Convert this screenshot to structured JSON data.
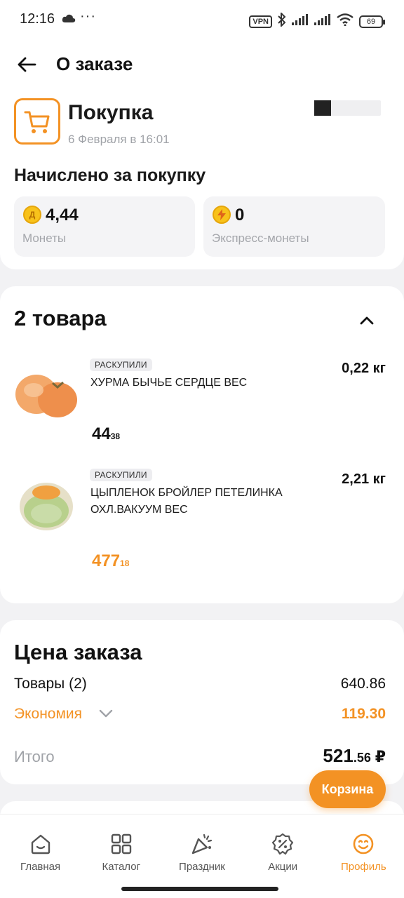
{
  "status_bar": {
    "time": "12:16",
    "dots": "···",
    "vpn": "VPN",
    "battery": "69",
    "icons": [
      "cloud-icon",
      "bluetooth-icon",
      "signal-icon",
      "signal-icon",
      "wifi-icon",
      "battery-icon"
    ]
  },
  "header": {
    "title": "О заказе",
    "back_icon": "arrow-left-icon"
  },
  "purchase": {
    "title": "Покупка",
    "date": "6 Февраля в 16:01",
    "icon": "cart-icon",
    "accrued_title": "Начислено за покупку",
    "coins": {
      "value": "4,44",
      "label": "Монеты",
      "icon_letter": "Д"
    },
    "express": {
      "value": "0",
      "label": "Экспресс-монеты"
    }
  },
  "items": {
    "title": "2 товара",
    "collapse_icon": "chevron-up-icon",
    "products": [
      {
        "badge": "РАСКУПИЛИ",
        "name": "ХУРМА БЫЧЬЕ СЕРДЦЕ ВЕС",
        "qty": "0,22 кг",
        "price_int": "44",
        "price_frac": "38"
      },
      {
        "badge": "РАСКУПИЛИ",
        "name": "ЦЫПЛЕНОК БРОЙЛЕР ПЕТЕЛИНКА ОХЛ.ВАКУУМ ВЕС",
        "qty": "2,21 кг",
        "price_int": "477",
        "price_frac": "18"
      }
    ]
  },
  "summary": {
    "title": "Цена заказа",
    "goods_label": "Товары (2)",
    "goods_value": "640.86",
    "economy_label": "Экономия",
    "economy_value": "119.30",
    "total_label": "Итого",
    "total_int": "521",
    "total_frac": ".56",
    "currency": "₽"
  },
  "fab": {
    "label": "Корзина"
  },
  "nav": [
    {
      "label": "Главная",
      "icon": "home-icon"
    },
    {
      "label": "Каталог",
      "icon": "catalog-icon"
    },
    {
      "label": "Праздник",
      "icon": "celebration-icon"
    },
    {
      "label": "Акции",
      "icon": "discount-icon"
    },
    {
      "label": "Профиль",
      "icon": "profile-icon",
      "active": true
    }
  ],
  "colors": {
    "accent": "#f39224",
    "text": "#111111",
    "muted": "#a0a3a8",
    "background": "#f2f2f4"
  }
}
